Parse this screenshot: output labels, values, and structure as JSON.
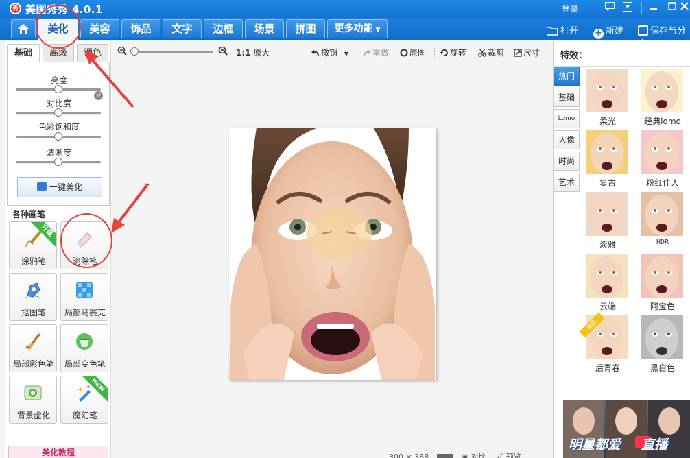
{
  "app": {
    "title": "美图秀秀 4.0.1",
    "login": "登录",
    "logo_text": "秀"
  },
  "tabs": [
    {
      "label": "美化",
      "active": true
    },
    {
      "label": "美容"
    },
    {
      "label": "饰品"
    },
    {
      "label": "文字"
    },
    {
      "label": "边框"
    },
    {
      "label": "场景"
    },
    {
      "label": "拼图"
    },
    {
      "label": "更多功能"
    }
  ],
  "header_actions": {
    "open": "打开",
    "new": "新建",
    "save": "保存与分享"
  },
  "left_panel": {
    "subtabs": [
      "基础",
      "高级",
      "调色"
    ],
    "sliders": [
      {
        "label": "亮度",
        "value": 0.5
      },
      {
        "label": "对比度",
        "value": 0.5
      },
      {
        "label": "色彩饱和度",
        "value": 0.5
      },
      {
        "label": "清晰度",
        "value": 0.5
      }
    ],
    "one_key": "一键美化",
    "brushes_title": "各种画笔",
    "brushes": [
      {
        "label": "涂鸦笔",
        "badge": "升级"
      },
      {
        "label": "消除笔"
      },
      {
        "label": "抠图笔"
      },
      {
        "label": "局部马赛克"
      },
      {
        "label": "局部彩色笔"
      },
      {
        "label": "局部变色笔"
      },
      {
        "label": "背景虚化"
      },
      {
        "label": "魔幻笔",
        "badge": "new"
      }
    ],
    "tutorial": "美化教程"
  },
  "toolbar": {
    "zoom_ratio": "1:1",
    "original_size": "原大",
    "undo": "撤销",
    "redo": "重做",
    "original": "原图",
    "rotate": "旋转",
    "crop": "裁剪",
    "resize": "尺寸"
  },
  "status": {
    "dimensions": "300 × 368",
    "compare": "对比",
    "preview": "预览"
  },
  "effects_panel": {
    "title": "特效：",
    "categories": [
      "热门",
      "基础",
      "Lomo",
      "人像",
      "时尚",
      "艺术"
    ],
    "effects": [
      {
        "label": "柔光"
      },
      {
        "label": "经典lomo"
      },
      {
        "label": "复古"
      },
      {
        "label": "粉红佳人"
      },
      {
        "label": "淡雅"
      },
      {
        "label": "HDR"
      },
      {
        "label": "云端"
      },
      {
        "label": "阿宝色"
      },
      {
        "label": "后青春",
        "badge": "会员"
      },
      {
        "label": "黑白色"
      }
    ],
    "ad_text": "明星都爱",
    "ad_live": "直播"
  },
  "colors": {
    "title_blue": "#1673d3",
    "annotation_red": "#e8423c",
    "badge_green": "#3fb83f"
  }
}
